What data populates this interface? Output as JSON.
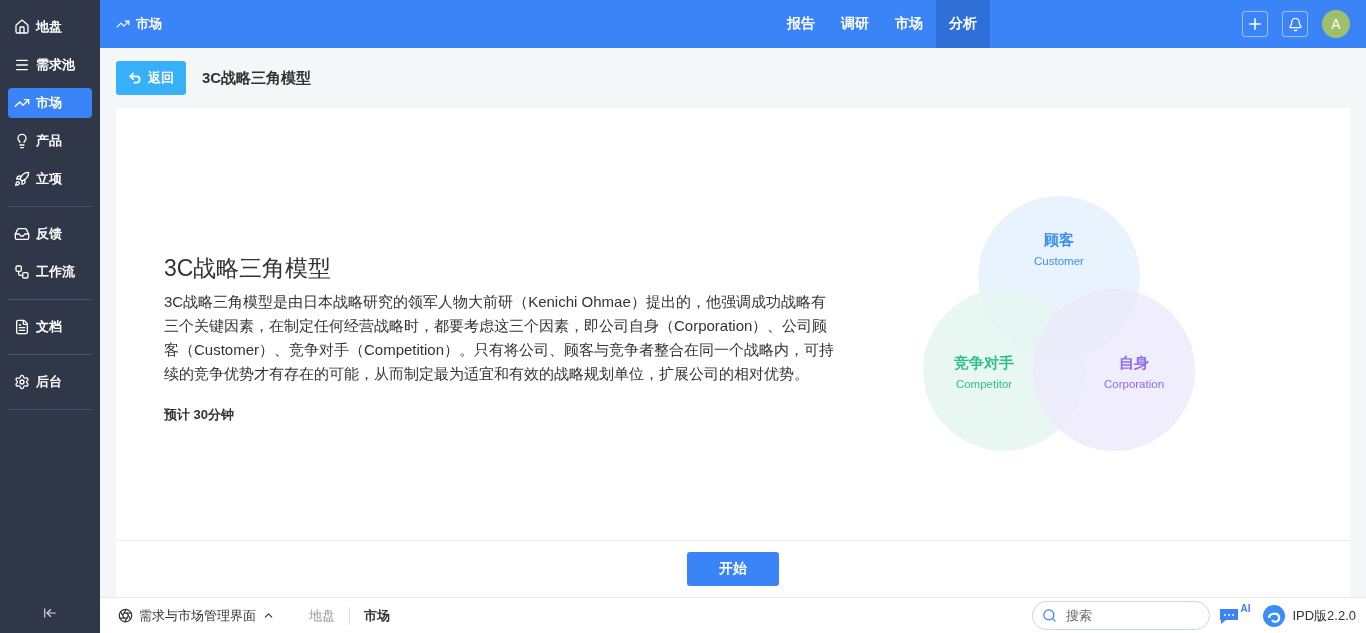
{
  "sidebar": {
    "groups": [
      [
        {
          "label": "地盘",
          "selected": false
        },
        {
          "label": "需求池",
          "selected": false
        },
        {
          "label": "市场",
          "selected": true
        },
        {
          "label": "产品",
          "selected": false
        },
        {
          "label": "立项",
          "selected": false
        }
      ],
      [
        {
          "label": "反馈",
          "selected": false
        },
        {
          "label": "工作流",
          "selected": false
        }
      ],
      [
        {
          "label": "文档",
          "selected": false
        }
      ],
      [
        {
          "label": "后台",
          "selected": false
        }
      ]
    ]
  },
  "topbar": {
    "title": "市场",
    "tabs": [
      {
        "label": "报告",
        "selected": false
      },
      {
        "label": "调研",
        "selected": false
      },
      {
        "label": "市场",
        "selected": false
      },
      {
        "label": "分析",
        "selected": true
      }
    ],
    "avatar": "A"
  },
  "header": {
    "back_button": "返回",
    "title": "3C战略三角模型"
  },
  "intro": {
    "heading": "3C战略三角模型",
    "description": "3C战略三角模型是由日本战略研究的领军人物大前研（Kenichi Ohmae）提出的，他强调成功战略有三个关键因素，在制定任何经营战略时，都要考虑这三个因素，即公司自身（Corporation）、公司顾客（Customer）、竞争对手（Competition）。只有将公司、顾客与竞争者整合在同一个战略内，可持续的竞争优势才有存在的可能，从而制定最为适宜和有效的战略规划单位，扩展公司的相对优势。",
    "duration": "预计 30分钟"
  },
  "venn": [
    {
      "title": "顾客",
      "subtitle": "Customer",
      "color": "#3b8ff5"
    },
    {
      "title": "竞争对手",
      "subtitle": "Competitor",
      "color": "#2fbf8c"
    },
    {
      "title": "自身",
      "subtitle": "Corporation",
      "color": "#8a6cf0"
    }
  ],
  "start_button": "开始",
  "footer": {
    "workspace": "需求与市场管理界面",
    "breadcrumbs": [
      {
        "label": "地盘",
        "selected": false
      },
      {
        "label": "市场",
        "selected": true
      }
    ],
    "search": {
      "placeholder": "搜索"
    },
    "ai_badge": "AI",
    "version": "IPD版2.2.0"
  }
}
